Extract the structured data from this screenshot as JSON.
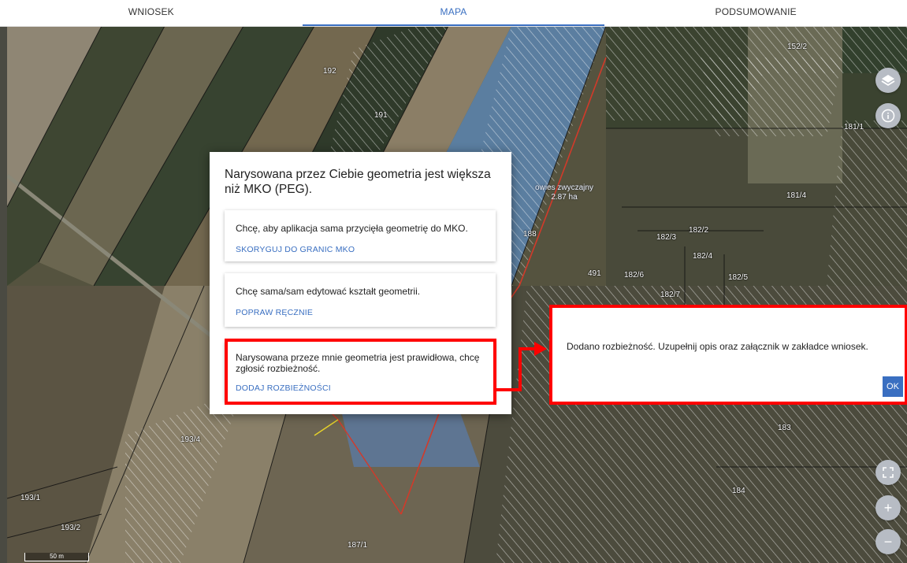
{
  "tabs": [
    {
      "label": "WNIOSEK",
      "active": false
    },
    {
      "label": "MAPA",
      "active": true
    },
    {
      "label": "PODSUMOWANIE",
      "active": false
    }
  ],
  "map": {
    "parcels": [
      "192",
      "191",
      "188",
      "491",
      "182/2",
      "182/3",
      "182/4",
      "182/5",
      "182/6",
      "182/7",
      "181/1",
      "181/4",
      "152/2",
      "183",
      "184",
      "193/4",
      "193/1",
      "193/2",
      "187/1"
    ],
    "crop": {
      "name": "owies zwyczajny",
      "area": "2.87 ha"
    },
    "scale_label": "50 m"
  },
  "controls": {
    "layers": "layers-icon",
    "info": "info-icon",
    "fullscreen": "fullscreen-icon",
    "zoom_in": "+",
    "zoom_out": "−"
  },
  "dialog": {
    "title": "Narysowana przez Ciebie geometria jest większa niż MKO (PEG).",
    "options": [
      {
        "text": "Chcę, aby aplikacja sama przycięła geometrię do MKO.",
        "action": "SKORYGUJ DO GRANIC MKO"
      },
      {
        "text": "Chcę sama/sam edytować kształt geometrii.",
        "action": "POPRAW RĘCZNIE"
      },
      {
        "text": "Narysowana przeze mnie geometria jest prawidłowa, chcę zgłosić rozbieżność.",
        "action": "DODAJ ROZBIEŻNOŚCI"
      }
    ]
  },
  "notice": {
    "text": "Dodano rozbieżność. Uzupełnij opis oraz załącznik w zakładce wniosek.",
    "ok_label": "OK"
  },
  "colors": {
    "accent": "#3a6fc1",
    "highlight": "#ff0000"
  }
}
